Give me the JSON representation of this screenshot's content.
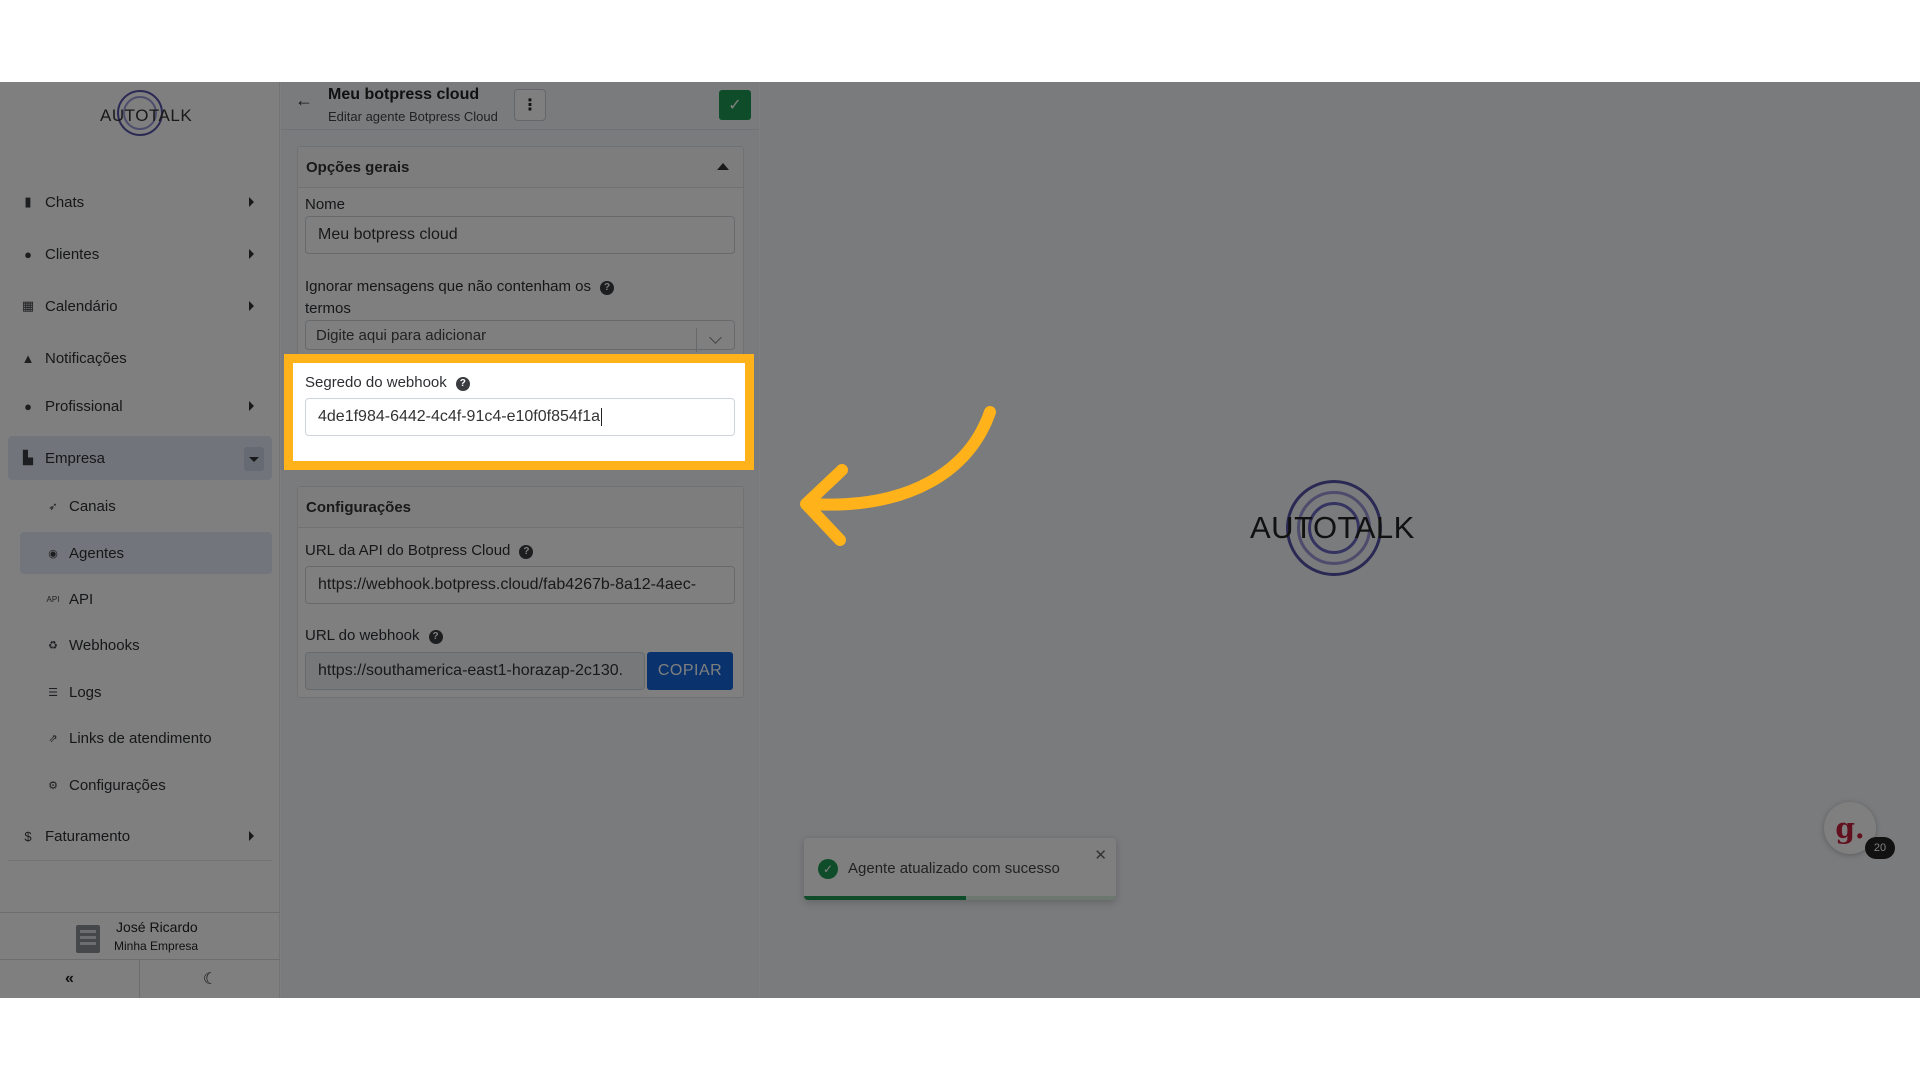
{
  "sidebar": {
    "logo_text": "AUTOTALK",
    "items": [
      {
        "label": "Chats",
        "icon": "chat-icon"
      },
      {
        "label": "Clientes",
        "icon": "users-icon"
      },
      {
        "label": "Calendário",
        "icon": "calendar-icon"
      },
      {
        "label": "Notificações",
        "icon": "bell-icon"
      },
      {
        "label": "Profissional",
        "icon": "user-cog-icon"
      },
      {
        "label": "Empresa",
        "icon": "building-icon"
      },
      {
        "label": "Faturamento",
        "icon": "dollar-icon"
      }
    ],
    "sub_items": [
      {
        "label": "Canais",
        "icon": "rocket-icon"
      },
      {
        "label": "Agentes",
        "icon": "robot-icon"
      },
      {
        "label": "API",
        "icon": "api-icon"
      },
      {
        "label": "Webhooks",
        "icon": "webhook-icon"
      },
      {
        "label": "Logs",
        "icon": "list-icon"
      },
      {
        "label": "Links de atendimento",
        "icon": "external-link-icon"
      },
      {
        "label": "Configurações",
        "icon": "gear-icon"
      }
    ],
    "user_name": "José Ricardo",
    "user_company": "Minha Empresa",
    "collapse_symbol": "«",
    "theme_symbol": "☾"
  },
  "panel": {
    "back_symbol": "←",
    "title": "Meu botpress cloud",
    "subtitle": "Editar agente Botpress Cloud",
    "menu_symbol": "⋮",
    "save_symbol": "✓",
    "general_section": "Opções gerais",
    "name_label": "Nome",
    "name_value": "Meu botpress cloud",
    "ignore_label_line1": "Ignorar mensagens que não contenham os",
    "ignore_label_line2": "termos",
    "ignore_placeholder": "Digite aqui para adicionar",
    "webhook_secret_label": "Segredo do webhook",
    "webhook_secret_value": "4de1f984-6442-4c4f-91c4-e10f0f854f1a",
    "config_section": "Configurações",
    "api_url_label": "URL da API do Botpress Cloud",
    "api_url_value": "https://webhook.botpress.cloud/fab4267b-8a12-4aec-",
    "webhook_url_label": "URL do webhook",
    "webhook_url_value": "https://southamerica-east1-horazap-2c130.",
    "copy_label": "COPIAR",
    "help_symbol": "?"
  },
  "main": {
    "logo_text": "AUTOTALK",
    "chat_widget_letter": "g.",
    "chat_badge": "20"
  },
  "toast": {
    "message": "Agente atualizado com sucesso",
    "close_symbol": "✕",
    "check_symbol": "✓",
    "progress": 0.52
  },
  "colors": {
    "highlight": "#ffb21a",
    "arrow": "#ffb21a",
    "primary_button": "#1565d8",
    "success": "#1e9a55",
    "logo_ring": "#5552a8"
  }
}
